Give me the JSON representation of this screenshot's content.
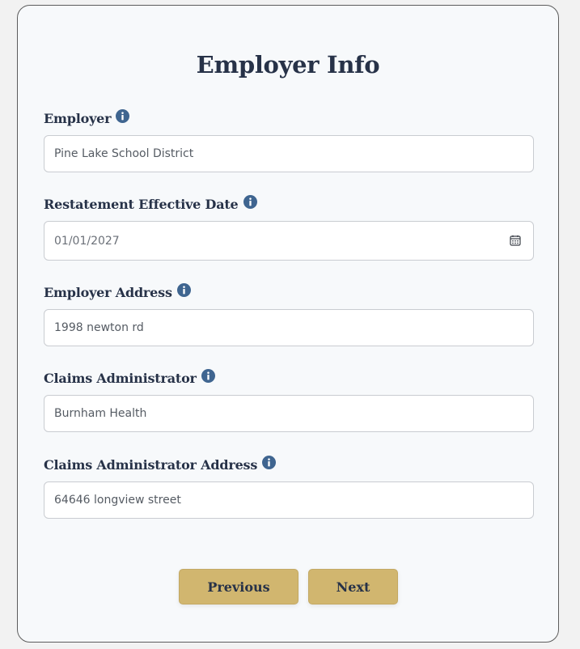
{
  "page": {
    "title": "Employer Info"
  },
  "fields": {
    "employer": {
      "label": "Employer",
      "value": "Pine Lake School District"
    },
    "restatement_date": {
      "label": "Restatement Effective Date",
      "value": "01/01/2027"
    },
    "employer_address": {
      "label": "Employer Address",
      "value": "1998 newton rd"
    },
    "claims_admin": {
      "label": "Claims Administrator",
      "value": "Burnham Health"
    },
    "claims_admin_address": {
      "label": "Claims Administrator Address",
      "value": "64646 longview street"
    }
  },
  "buttons": {
    "previous": "Previous",
    "next": "Next"
  },
  "colors": {
    "heading": "#273248",
    "info_icon": "#3f6590",
    "button_bg": "#d1b66f",
    "card_bg": "#f7f9fb",
    "card_border": "#5c5c5c"
  },
  "icons": {
    "info": "info-circle-icon",
    "date": "calendar-icon"
  }
}
